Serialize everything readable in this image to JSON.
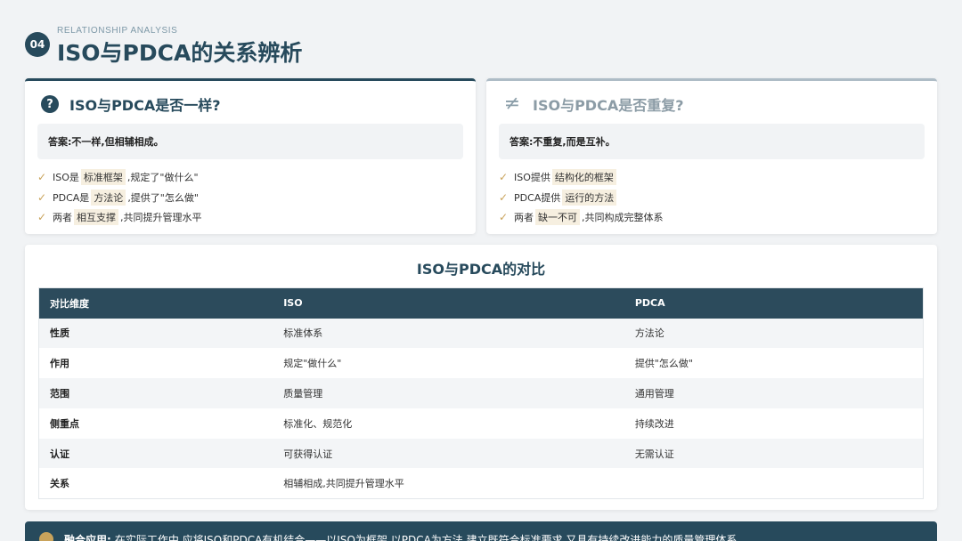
{
  "header": {
    "number": "04",
    "eyebrow": "RELATIONSHIP ANALYSIS",
    "title": "ISO与PDCA的关系辨析"
  },
  "cards": [
    {
      "icon": "question-icon",
      "icon_glyph": "?",
      "title": "ISO与PDCA是否一样?",
      "answer": "答案:不一样,但相辅相成。",
      "points": [
        {
          "before": "ISO是",
          "highlight": "标准框架",
          "after": ",规定了\"做什么\""
        },
        {
          "before": "PDCA是",
          "highlight": "方法论",
          "after": ",提供了\"怎么做\""
        },
        {
          "before": "两者",
          "highlight": "相互支撑",
          "after": ",共同提升管理水平"
        }
      ]
    },
    {
      "icon": "not-equal-icon",
      "icon_glyph": "≠",
      "title": "ISO与PDCA是否重复?",
      "answer": "答案:不重复,而是互补。",
      "points": [
        {
          "before": "ISO提供",
          "highlight": "结构化的框架",
          "after": ""
        },
        {
          "before": "PDCA提供",
          "highlight": "运行的方法",
          "after": ""
        },
        {
          "before": "两者",
          "highlight": "缺一不可",
          "after": ",共同构成完整体系"
        }
      ]
    }
  ],
  "table": {
    "title": "ISO与PDCA的对比",
    "columns": [
      "对比维度",
      "ISO",
      "PDCA"
    ],
    "rows": [
      [
        "性质",
        "标准体系",
        "方法论"
      ],
      [
        "作用",
        "规定\"做什么\"",
        "提供\"怎么做\""
      ],
      [
        "范围",
        "质量管理",
        "通用管理"
      ],
      [
        "侧重点",
        "标准化、规范化",
        "持续改进"
      ],
      [
        "认证",
        "可获得认证",
        "无需认证"
      ],
      [
        "关系",
        "相辅相成,共同提升管理水平",
        ""
      ]
    ]
  },
  "footer": {
    "icon": "lightbulb-icon",
    "label": "融合应用:",
    "text": "在实际工作中,应将ISO和PDCA有机结合——以ISO为框架,以PDCA为方法,建立既符合标准要求,又具有持续改进能力的质量管理体系。"
  },
  "colors": {
    "primary": "#274a5c",
    "accent": "#c9a35b",
    "muted": "#8c9ca6"
  }
}
